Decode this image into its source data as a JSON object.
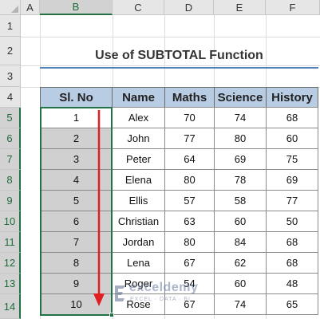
{
  "columns": [
    "A",
    "B",
    "C",
    "D",
    "E",
    "F"
  ],
  "rows": [
    "1",
    "2",
    "3",
    "4",
    "5",
    "6",
    "7",
    "8",
    "9",
    "10",
    "11",
    "12",
    "13",
    "14"
  ],
  "title": "Use of SUBTOTAL Function",
  "table": {
    "headers": [
      "Sl. No",
      "Name",
      "Maths",
      "Science",
      "History"
    ],
    "rows": [
      [
        "1",
        "Alex",
        "70",
        "74",
        "68"
      ],
      [
        "2",
        "John",
        "77",
        "80",
        "60"
      ],
      [
        "3",
        "Peter",
        "64",
        "69",
        "75"
      ],
      [
        "4",
        "Elena",
        "80",
        "78",
        "69"
      ],
      [
        "5",
        "Ellis",
        "57",
        "58",
        "77"
      ],
      [
        "6",
        "Christian",
        "63",
        "60",
        "50"
      ],
      [
        "7",
        "Jordan",
        "80",
        "84",
        "68"
      ],
      [
        "8",
        "Lena",
        "67",
        "62",
        "68"
      ],
      [
        "9",
        "Roger",
        "54",
        "60",
        "48"
      ],
      [
        "10",
        "Rose",
        "67",
        "74",
        "65"
      ]
    ]
  },
  "watermark": {
    "name": "exceldemy",
    "tagline": "EXCEL · DATA · BI"
  },
  "colors": {
    "header_fill": "#b8cce4",
    "title_underline": "#4f81bd",
    "selection": "#217346",
    "arrow": "#e02020",
    "grey_fill": "#d0d0d0"
  }
}
